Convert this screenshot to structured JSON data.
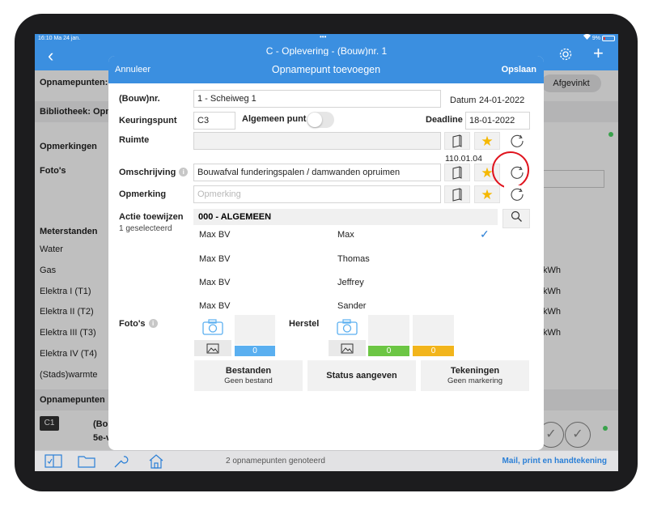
{
  "status": {
    "time": "16:10  Ma 24 jan.",
    "dots": "•••",
    "battery": "9%"
  },
  "nav": {
    "back_icon": "chevron-left-icon",
    "title": "C - Oplevering - (Bouw)nr. 1"
  },
  "background": {
    "opnamepunten": "Opnamepunten:",
    "afgevinkt": "Afgevinkt",
    "bibliotheek": "Bibliotheek: Opn",
    "opmerkingen": "Opmerkingen",
    "fotos": "Foto's",
    "meterstanden": "Meterstanden",
    "meters": [
      "Water",
      "Gas",
      "Elektra I (T1)",
      "Elektra II (T2)",
      "Elektra III (T3)",
      "Elektra IV (T4)",
      "(Stads)warmte"
    ],
    "unit": "kWh",
    "opnamepunten_section": "Opnamepunten",
    "c1": "C1",
    "item_line1": "(Bou",
    "item_line2": "5e-v"
  },
  "toolbar": {
    "count_text": "2 opnamepunten genoteerd",
    "mail_text": "Mail, print en handtekening"
  },
  "modal": {
    "cancel": "Annuleer",
    "title": "Opnamepunt toevoegen",
    "save": "Opslaan",
    "bouwnr_label": "(Bouw)nr.",
    "bouwnr_value": "1 - Scheiweg 1",
    "datum_label": "Datum",
    "datum_value": "24-01-2022",
    "keuringspunt_label": "Keuringspunt",
    "keuringspunt_value": "C3",
    "algemeen_label": "Algemeen punt",
    "deadline_label": "Deadline",
    "deadline_value": "18-01-2022",
    "ruimte_label": "Ruimte",
    "code": "110.01.04",
    "omschrijving_label": "Omschrijving",
    "omschrijving_value": "Bouwafval funderingspalen / damwanden opruimen",
    "opmerking_label": "Opmerking",
    "opmerking_placeholder": "Opmerking",
    "actie_label": "Actie toewijzen",
    "actie_sub": "1 geselecteerd",
    "group": "000 - ALGEMEEN",
    "assignees": [
      {
        "company": "Max BV",
        "name": "Max",
        "selected": true
      },
      {
        "company": "Max BV",
        "name": "Thomas",
        "selected": false
      },
      {
        "company": "Max BV",
        "name": "Jeffrey",
        "selected": false
      },
      {
        "company": "Max BV",
        "name": "Sander",
        "selected": false
      }
    ],
    "fotos_label": "Foto's",
    "herstel_label": "Herstel",
    "foto_count": "0",
    "herstel_green_count": "0",
    "herstel_yellow_count": "0",
    "bestanden_title": "Bestanden",
    "bestanden_sub": "Geen bestand",
    "status_title": "Status aangeven",
    "tekeningen_title": "Tekeningen",
    "tekeningen_sub": "Geen markering"
  },
  "colors": {
    "accent": "#3b8fe0",
    "star": "#f5b800",
    "count_blue": "#5aaff0",
    "count_green": "#6cc644",
    "count_yellow": "#f2b51c",
    "highlight_red": "#e0141e"
  }
}
